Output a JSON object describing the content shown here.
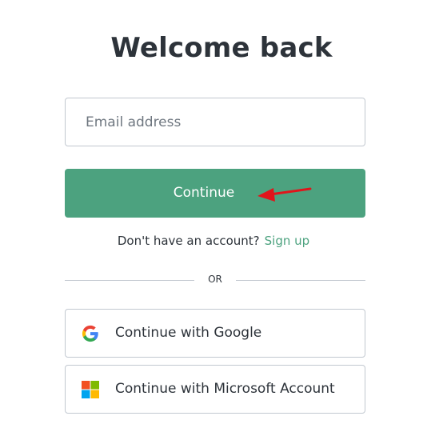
{
  "page": {
    "title": "Welcome back"
  },
  "login_form": {
    "email_placeholder": "Email address",
    "continue_label": "Continue",
    "signup_prompt": "Don't have an account?",
    "signup_link": "Sign up",
    "divider_text": "OR"
  },
  "social_logins": {
    "google_label": "Continue with Google",
    "microsoft_label": "Continue with Microsoft Account"
  },
  "colors": {
    "accent": "#4ca27f",
    "text": "#2d333a",
    "border": "#c2c8d0",
    "annotation": "#e0151b"
  },
  "icons": {
    "google": "google-logo-icon",
    "microsoft": "microsoft-logo-icon",
    "annotation": "red-arrow-icon"
  }
}
